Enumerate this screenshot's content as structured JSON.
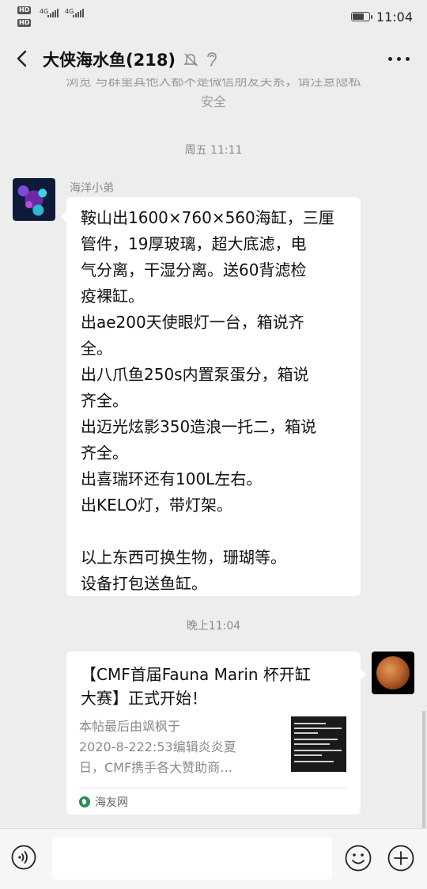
{
  "status_bar": {
    "hd1": "HD",
    "hd2": "HD",
    "net1": "4G",
    "net2": "4G",
    "battery_level": 0.75,
    "time": "11:04"
  },
  "header": {
    "title": "大侠海水鱼(218)"
  },
  "system_notice": {
    "line1": "浏览 与群里其他人都不是微信朋友关系，请注意隐私",
    "line2": "安全"
  },
  "timestamps": {
    "first": "周五 11:11",
    "second": "晚上11:04"
  },
  "message1": {
    "sender": "海洋小弟",
    "lines": [
      "鞍山出1600×760×560海缸，三厘",
      "管件，19厚玻璃，超大底滤，电",
      "气分离，干湿分离。送60背滤检",
      "疫裸缸。",
      "出ae200天使眼灯一台，箱说齐",
      "全。",
      "出八爪鱼250s内置泵蛋分，箱说",
      "齐全。",
      "出迈光炫影350造浪一托二，箱说",
      "齐全。",
      "出喜瑞环还有100L左右。",
      "出KELO灯，带灯架。",
      "",
      "以上东西可换生物，珊瑚等。",
      "设备打包送鱼缸。"
    ]
  },
  "card": {
    "title_lines": [
      "【CMF首届Fauna Marin 杯开缸",
      "大赛】正式开始！"
    ],
    "desc_lines": [
      "本帖最后由飒枫于",
      "2020-8-222:53编辑炎炎夏",
      "日，CMF携手各大赞助商…"
    ],
    "source": "海友网"
  }
}
